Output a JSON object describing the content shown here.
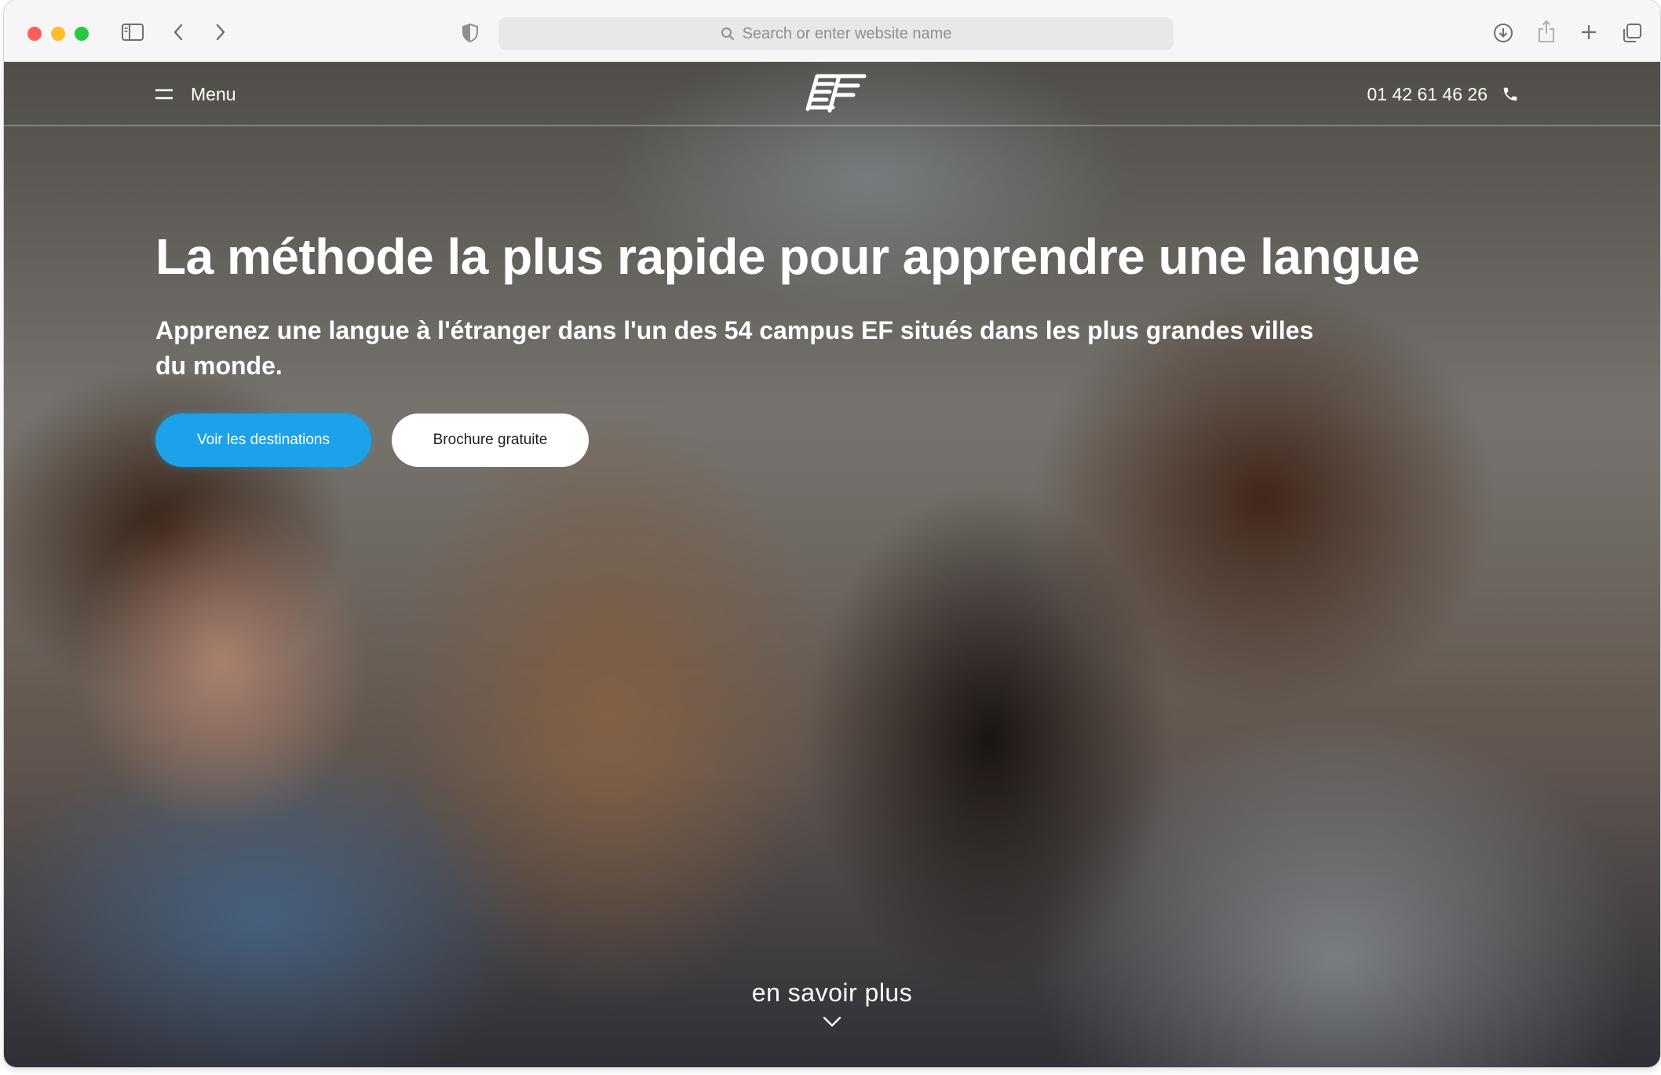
{
  "browser": {
    "address_placeholder": "Search or enter website name",
    "icons": [
      "sidebar-icon",
      "back-icon",
      "forward-icon",
      "shield-icon",
      "search-icon",
      "download-icon",
      "share-icon",
      "new-tab-icon",
      "tabs-overview-icon"
    ]
  },
  "nav": {
    "menu_label": "Menu",
    "logo_text": "EF",
    "phone": "01 42 61 46 26"
  },
  "hero": {
    "title": "La méthode la plus rapide pour apprendre une langue",
    "subtitle": "Apprenez une langue à l'étranger dans l'un des 54 campus EF situés dans les plus grandes villes du monde.",
    "primary_button": "Voir les destinations",
    "secondary_button": "Brochure gratuite",
    "learn_more": "en savoir plus"
  },
  "colors": {
    "primary_button": "#1ca2e8",
    "secondary_button": "#ffffff",
    "text_on_hero": "#ffffff"
  }
}
